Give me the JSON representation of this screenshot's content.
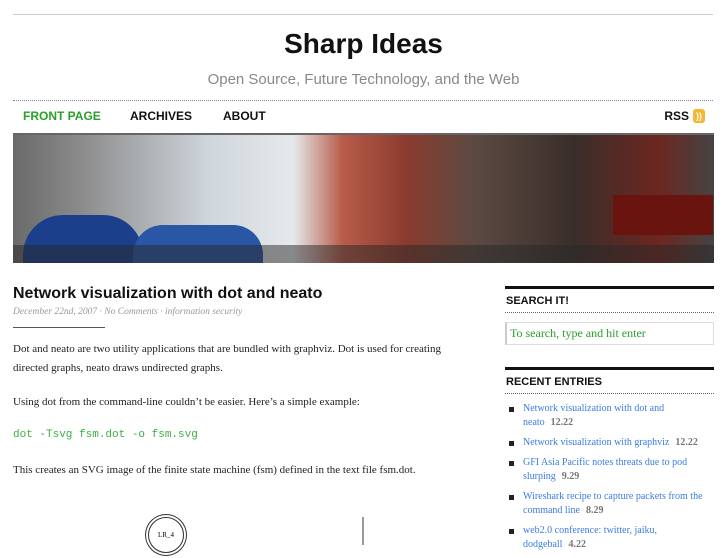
{
  "site": {
    "title": "Sharp Ideas",
    "tagline": "Open Source, Future Technology, and the Web"
  },
  "nav": {
    "items": [
      {
        "label": "FRONT PAGE",
        "active": true
      },
      {
        "label": "ARCHIVES"
      },
      {
        "label": "ABOUT"
      }
    ],
    "rss": "RSS",
    "active_color": "#2aa02a"
  },
  "post": {
    "title": "Network visualization with dot and neato",
    "date": "December 22nd, 2007",
    "comments": "No Comments",
    "category": "information security",
    "sep": " · ",
    "p1": "Dot and neato are two utility applications that are bundled with graphviz.  Dot is used for creating directed graphs, neato draws undirected graphs.",
    "p2": "Using dot from the command-line couldn’t be easier.  Here’s a simple example:",
    "code": "dot -Tsvg fsm.dot -o fsm.svg",
    "p3": "This creates an SVG image of the finite state machine (fsm) defined in the text file fsm.dot.",
    "node_label": "LR_4"
  },
  "sidebar": {
    "search_title": "SEARCH IT!",
    "search_placeholder": "To search, type and hit enter",
    "recent_title": "RECENT ENTRIES",
    "entries": [
      {
        "title": "Network visualization with dot and neato",
        "date": "12.22"
      },
      {
        "title": "Network visualization with graphviz",
        "date": "12.22"
      },
      {
        "title": "GFI Asia Pacific notes threats due to pod slurping",
        "date": "9.29"
      },
      {
        "title": "Wireshark recipe to capture packets from the command line",
        "date": "8.29"
      },
      {
        "title": "web2.0 conference: twitter, jaiku, dodgeball",
        "date": "4.22"
      }
    ]
  }
}
